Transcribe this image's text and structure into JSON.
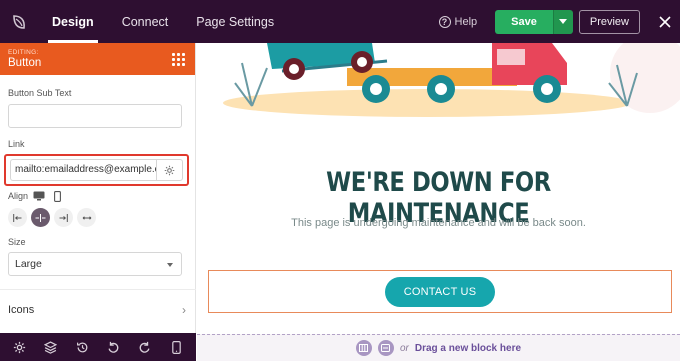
{
  "topbar": {
    "tabs": [
      {
        "label": "Design"
      },
      {
        "label": "Connect"
      },
      {
        "label": "Page Settings"
      }
    ],
    "help_label": "Help",
    "save_label": "Save",
    "preview_label": "Preview"
  },
  "sidebar": {
    "editing_label": "EDITING:",
    "editing_title": "Button",
    "sub_text_label": "Button Sub Text",
    "sub_text_value": "",
    "link_label": "Link",
    "link_value": "mailto:emailaddress@example.com",
    "align_label": "Align",
    "size_label": "Size",
    "size_value": "Large",
    "icons_label": "Icons"
  },
  "canvas": {
    "headline": "WE'RE DOWN FOR MAINTENANCE",
    "subtext": "This page is undergoing maintenance and will be back soon.",
    "button_label": "CONTACT US",
    "drop_or": "or",
    "drop_text": "Drag a new block here"
  },
  "colors": {
    "topbar_bg": "#2e0f31",
    "editing_header": "#e85a1f",
    "save_green": "#27ae60",
    "button_teal": "#16a6ad",
    "headline": "#1f4a4a",
    "highlight_red": "#e0392d"
  }
}
